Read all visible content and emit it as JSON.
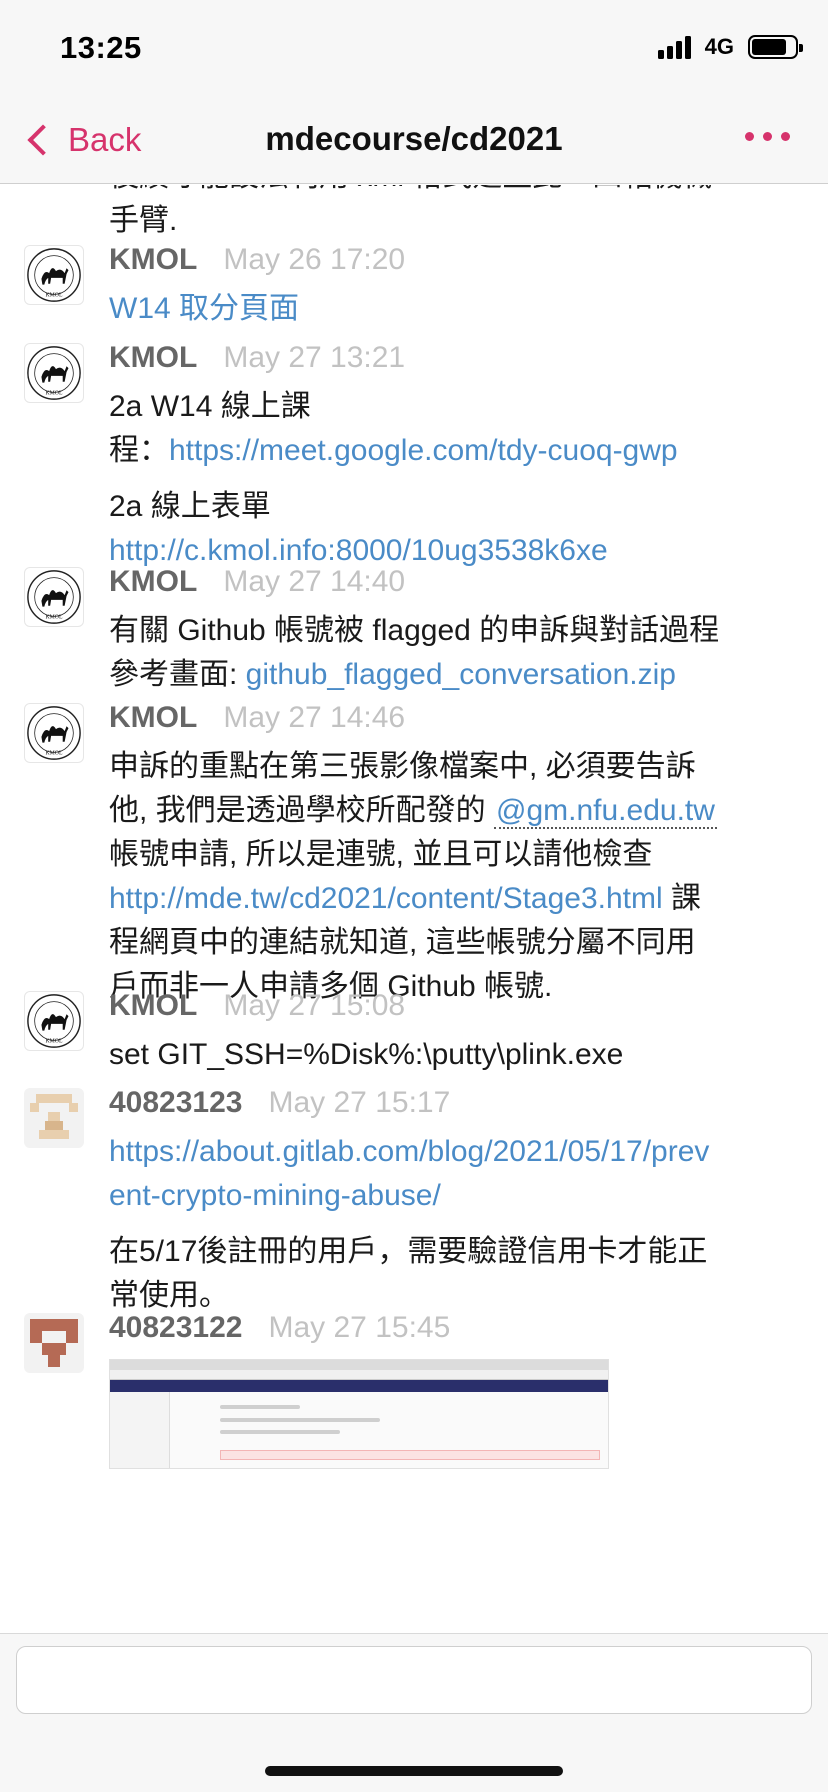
{
  "status_bar": {
    "time": "13:25",
    "network": "4G",
    "battery_level": 0.85
  },
  "nav": {
    "back_label": "Back",
    "title": "mdecourse/cd2021",
    "more_icon": "ellipsis-icon"
  },
  "previous_fragment": {
    "line1": "後續才能設法利用 xml 格式建立此一四軸機械",
    "line2": "手臂."
  },
  "messages": [
    {
      "author": "KMOL",
      "time": "May 26 17:20",
      "link": "W14 取分頁面"
    },
    {
      "author": "KMOL",
      "time": "May 27 13:21",
      "p1_text_a": "2a W14 線上課",
      "p1_text_b": "程：",
      "p1_link": "https://meet.google.com/tdy-cuoq-gwp",
      "p2_text": "2a 線上表單",
      "p2_link": "http://c.kmol.info:8000/10ug3538k6xe"
    },
    {
      "author": "KMOL",
      "time": "May 27 14:40",
      "text": "有關 Github 帳號被 flagged 的申訴與對話過程",
      "text2": "參考畫面: ",
      "link": "github_flagged_conversation.zip"
    },
    {
      "author": "KMOL",
      "time": "May 27 14:46",
      "text_a": "申訴的重點在第三張影像檔案中, 必須要告訴",
      "text_b": "他, 我們是透過學校所配發的 ",
      "mention": "@gm.nfu.edu.tw",
      "text_c": "帳號申請, 所以是連號, 並且可以請他檢查",
      "link": "http://mde.tw/cd2021/content/Stage3.html",
      "text_d": " 課",
      "text_e": "程網頁中的連結就知道, 這些帳號分屬不同用",
      "text_f": "戶而非一人申請多個 Github 帳號."
    },
    {
      "author": "KMOL",
      "time": "May 27 15:08",
      "text": "set GIT_SSH=%Disk%:\\putty\\plink.exe"
    },
    {
      "author": "40823123",
      "time": "May 27 15:17",
      "link_a": "https://about.gitlab.com/blog/2021/05/17/prev",
      "link_b": "ent-crypto-mining-abuse/",
      "text_a": "在5/17後註冊的用戶，需要驗證信用卡才能正",
      "text_b": "常使用。"
    },
    {
      "author": "40823122",
      "time": "May 27 15:45"
    }
  ],
  "composer": {
    "placeholder": ""
  },
  "colors": {
    "accent": "#d6336c",
    "link": "#4a8bc7",
    "author": "#666666",
    "timestamp": "#c2c2c2"
  }
}
